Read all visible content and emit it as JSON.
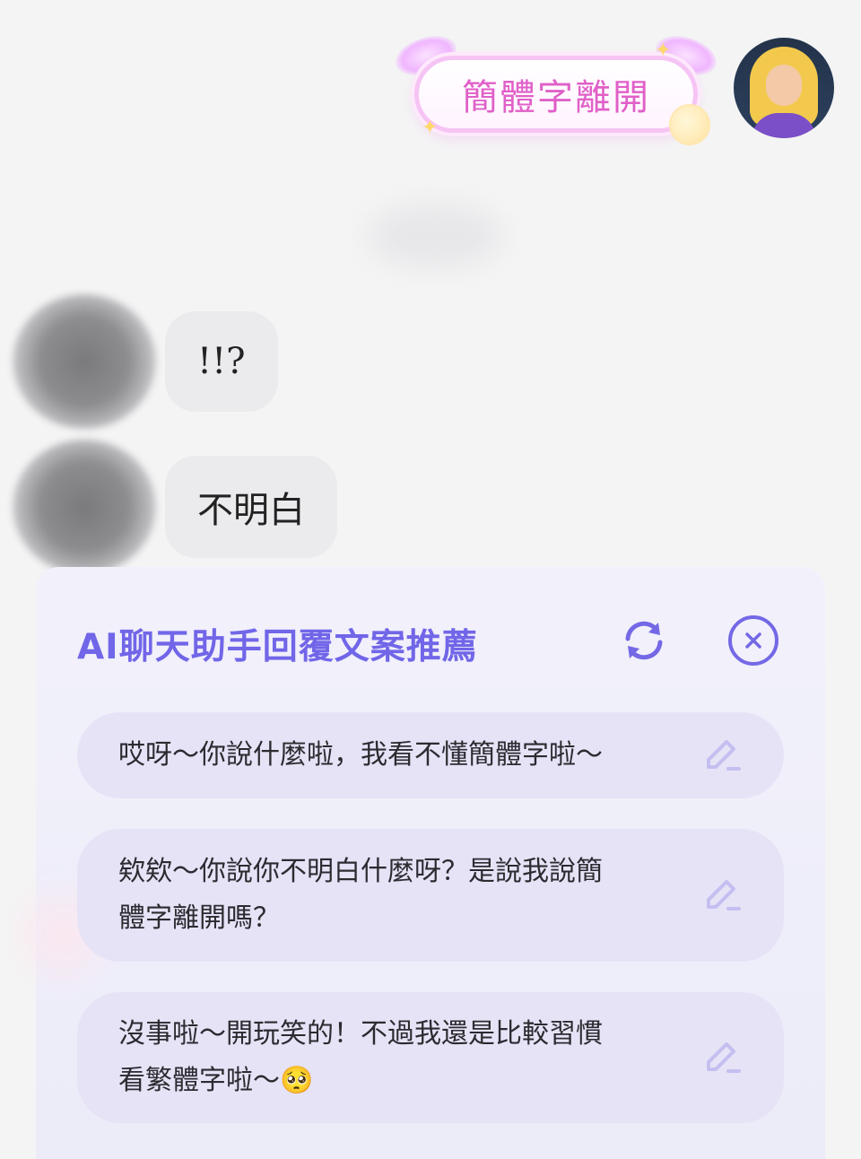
{
  "outgoing": {
    "sticker_text": "簡體字離開"
  },
  "incoming": [
    {
      "text": "!!?"
    },
    {
      "text": "不明白"
    }
  ],
  "ai_panel": {
    "title": "AI聊天助手回覆文案推薦",
    "refresh_icon": "refresh-icon",
    "close_icon": "close-circle-icon",
    "accent_color": "#7166e8",
    "suggestions": [
      {
        "line1": "哎呀～你說什麼啦，我看不懂簡體字啦～",
        "line2": ""
      },
      {
        "line1": "欸欸～你說你不明白什麼呀？是說我說簡",
        "line2": "體字離開嗎？"
      },
      {
        "line1": "沒事啦～開玩笑的！不過我還是比較習慣",
        "line2": "看繁體字啦～🥺"
      }
    ]
  }
}
